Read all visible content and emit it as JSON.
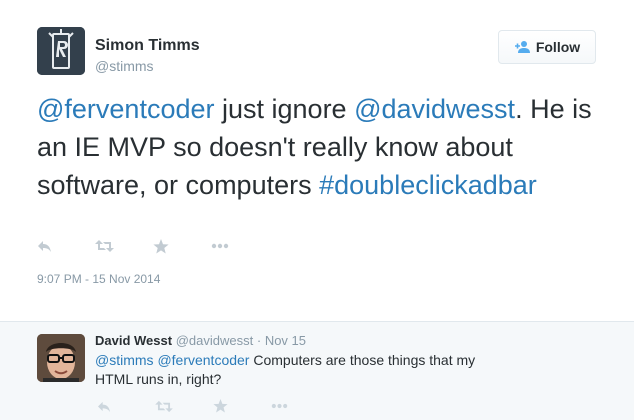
{
  "tweet": {
    "author_name": "Simon Timms",
    "author_handle": "@stimms",
    "follow_label": "Follow",
    "mention_1": "@ferventcoder",
    "text_1": " just ignore ",
    "mention_2": "@davidwesst",
    "text_2": ". He is an IE MVP so doesn't really know about software, or computers ",
    "hashtag": "#doubleclickadbar",
    "timestamp": "9:07 PM - 15 Nov 2014",
    "actions": [
      "reply-icon",
      "retweet-icon",
      "favorite-icon",
      "more-icon"
    ]
  },
  "reply": {
    "author_name": "David Wesst",
    "author_handle": "@davidwesst",
    "separator": "·",
    "date": "Nov 15",
    "mention_1": "@stimms",
    "mention_2": "@ferventcoder",
    "text": " Computers are those things that my HTML runs in, right?",
    "actions": [
      "reply-icon",
      "retweet-icon",
      "favorite-icon",
      "more-icon"
    ]
  },
  "colors": {
    "link": "#2b7bb9",
    "muted": "#8899a6",
    "text": "#292f33",
    "reply_background": "#f5f8fa"
  }
}
